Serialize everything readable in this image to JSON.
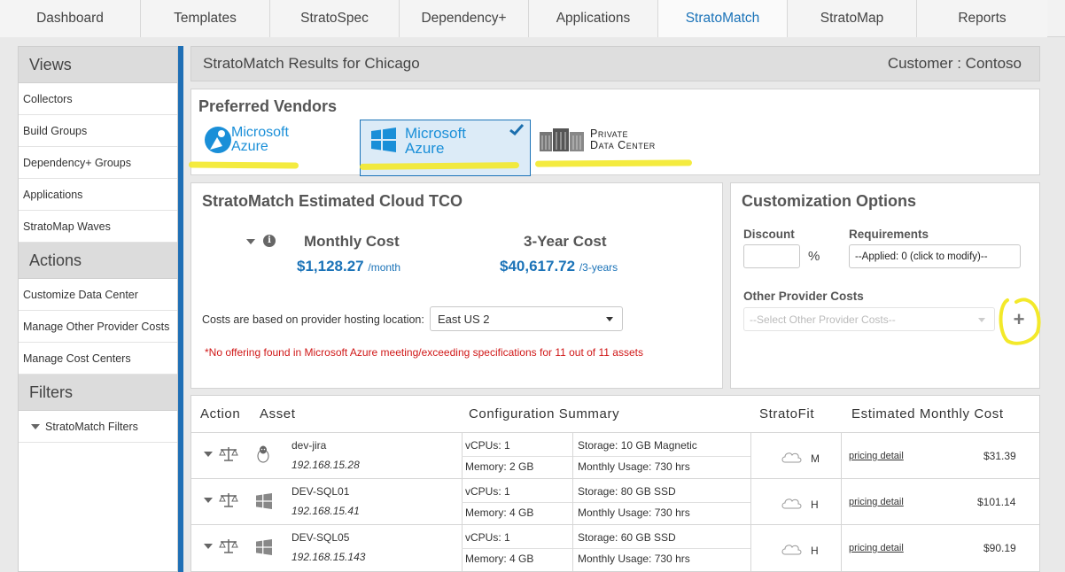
{
  "nav": {
    "tabs": [
      {
        "label": "Dashboard"
      },
      {
        "label": "Templates"
      },
      {
        "label": "StratoSpec"
      },
      {
        "label": "Dependency+"
      },
      {
        "label": "Applications"
      },
      {
        "label": "StratoMatch"
      },
      {
        "label": "StratoMap"
      },
      {
        "label": "Reports"
      }
    ],
    "active": "StratoMatch"
  },
  "sidebar": {
    "views_title": "Views",
    "views": [
      "Collectors",
      "Build Groups",
      "Dependency+ Groups",
      "Applications",
      "StratoMap Waves"
    ],
    "actions_title": "Actions",
    "actions": [
      "Customize Data Center",
      "Manage Other Provider Costs",
      "Manage Cost Centers"
    ],
    "filters_title": "Filters",
    "filter_item": "StratoMatch Filters"
  },
  "header": {
    "title": "StratoMatch Results for Chicago",
    "customer": "Customer : Contoso"
  },
  "vendors": {
    "title": "Preferred Vendors",
    "items": [
      {
        "line1": "Microsoft",
        "line2": "Azure",
        "selected": false
      },
      {
        "line1": "Microsoft",
        "line2": "Azure",
        "selected": true
      },
      {
        "line1": "Private",
        "line2": "Data Center",
        "selected": false
      }
    ]
  },
  "tco": {
    "title": "StratoMatch Estimated Cloud TCO",
    "monthly_label": "Monthly Cost",
    "monthly_value": "$1,128.27",
    "monthly_unit": "/month",
    "three_year_label": "3-Year Cost",
    "three_year_value": "$40,617.72",
    "three_year_unit": "/3-years",
    "basis_label": "Costs are based on provider hosting location:",
    "location": "East US 2",
    "warning": "*No offering found in Microsoft Azure meeting/exceeding specifications for 11 out of 11 assets"
  },
  "custom": {
    "title": "Customization Options",
    "discount_label": "Discount",
    "discount_value": "",
    "percent": "%",
    "requirements_label": "Requirements",
    "requirements_value": "--Applied: 0 (click to modify)--",
    "other_label": "Other Provider Costs",
    "other_placeholder": "--Select Other Provider Costs--",
    "add": "+"
  },
  "table": {
    "headers": {
      "action": "Action",
      "asset": "Asset",
      "config": "Configuration Summary",
      "fit": "StratoFit",
      "cost": "Estimated Monthly Cost"
    },
    "rows": [
      {
        "os": "linux",
        "name": "dev-jira",
        "ip": "192.168.15.28",
        "vcpus": "vCPUs:  1",
        "memory": "Memory:  2 GB",
        "storage": "Storage:  10 GB Magnetic",
        "usage": "Monthly Usage:  730 hrs",
        "fit": "M",
        "link": "pricing detail",
        "cost": "$31.39"
      },
      {
        "os": "windows",
        "name": "DEV-SQL01",
        "ip": "192.168.15.41",
        "vcpus": "vCPUs:  1",
        "memory": "Memory:  4 GB",
        "storage": "Storage:  80 GB SSD",
        "usage": "Monthly Usage:  730 hrs",
        "fit": "H",
        "link": "pricing detail",
        "cost": "$101.14"
      },
      {
        "os": "windows",
        "name": "DEV-SQL05",
        "ip": "192.168.15.143",
        "vcpus": "vCPUs:  1",
        "memory": "Memory:  4 GB",
        "storage": "Storage:  60 GB SSD",
        "usage": "Monthly Usage:  730 hrs",
        "fit": "H",
        "link": "pricing detail",
        "cost": "$90.19"
      }
    ]
  },
  "colors": {
    "accent": "#1b73b8",
    "sidebar_bar": "#1f6fb5",
    "warning": "#d01818",
    "highlight": "#f3e92a"
  }
}
